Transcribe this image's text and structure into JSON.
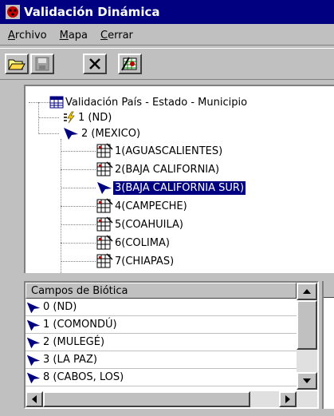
{
  "window": {
    "title": "Validación Dinámica"
  },
  "menu": [
    {
      "hotkey": "A",
      "rest": "rchivo"
    },
    {
      "hotkey": "M",
      "rest": "apa"
    },
    {
      "hotkey": "C",
      "rest": "errar"
    }
  ],
  "toolbar": {
    "buttons": [
      {
        "icon": "open-folder-icon"
      },
      {
        "icon": "save-icon"
      },
      {
        "icon": "close-x-icon"
      },
      {
        "icon": "validate-icon"
      }
    ]
  },
  "tree": {
    "root": "Validación País - Estado - Municipio",
    "country_nd": "1 (ND)",
    "country_mexico": "2 (MEXICO)",
    "states": [
      "1(AGUASCALIENTES)",
      "2(BAJA CALIFORNIA)",
      "3(BAJA CALIFORNIA SUR)",
      "4(CAMPECHE)",
      "5(COAHUILA)",
      "6(COLIMA)",
      "7(CHIAPAS)"
    ],
    "selected": "3(BAJA CALIFORNIA SUR)"
  },
  "list": {
    "header": "Campos de Biótica",
    "rows": [
      "0 (ND)",
      "1 (COMONDÚ)",
      "2 (MULEGÉ)",
      "3 (LA PAZ)",
      "8 (CABOS, LOS)"
    ]
  },
  "colors": {
    "titlebar": "#000080",
    "face": "#c0c0c0",
    "selection": "#000080",
    "arrow_icon": "#000080"
  }
}
